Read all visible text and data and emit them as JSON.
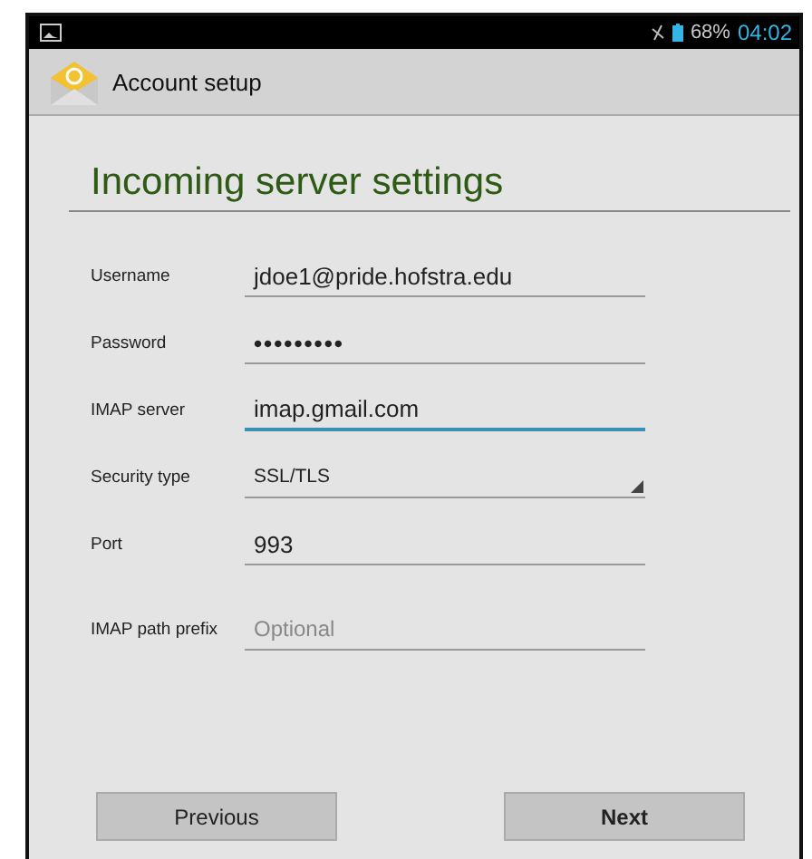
{
  "status_bar": {
    "battery": "68%",
    "time": "04:02"
  },
  "action_bar": {
    "title": "Account setup"
  },
  "heading": "Incoming server settings",
  "fields": [
    {
      "label": "Username",
      "kind": "text",
      "value": "jdoe1@pride.hofstra.edu",
      "focused": false
    },
    {
      "label": "Password",
      "kind": "password",
      "value": "•••••••••",
      "focused": false
    },
    {
      "label": "IMAP server",
      "kind": "text",
      "value": "imap.gmail.com",
      "focused": true
    },
    {
      "label": "Security type",
      "kind": "select",
      "value": "SSL/TLS",
      "focused": false
    },
    {
      "label": "Port",
      "kind": "text",
      "value": "993",
      "focused": false
    },
    {
      "label": "IMAP path prefix",
      "kind": "text",
      "placeholder": "Optional",
      "focused": false
    }
  ],
  "buttons": [
    "Previous",
    "Next"
  ]
}
